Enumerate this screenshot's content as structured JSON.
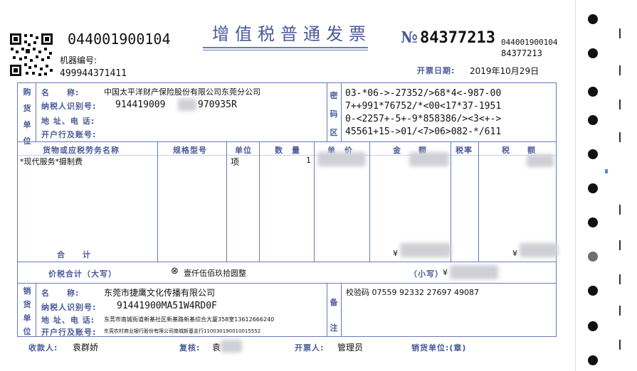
{
  "header": {
    "code_top": "044001900104",
    "machine_label": "机器编号:",
    "machine_no": "499944371411",
    "title": "增值税普通发票",
    "no_symbol": "№",
    "invoice_no": "84377213",
    "code_small": "044001900104",
    "no_small": "84377213",
    "date_label": "开票日期:",
    "date": "2019年10月29日"
  },
  "buyer": {
    "section_label": [
      "购",
      "货",
      "单",
      "位"
    ],
    "name_label": "名　　称:",
    "name": "中国太平洋财产保险股份有限公司东莞分公司",
    "tax_label": "纳税人识别号:",
    "tax_id_part1": "914419009",
    "tax_id_part2": "970935R",
    "addr_label": "地 址、电 话:",
    "bank_label": "开户行及账号:"
  },
  "cipher": {
    "label": [
      "密",
      "码",
      "区"
    ],
    "lines": [
      "03-*06->-27352/>68*4<-987-00",
      "7++991*76752/*<00<17*37-1951",
      "0-<2257+-5+-9*858386/><3<+->",
      "45561+15->01/<7>06>082-*/611"
    ]
  },
  "items": {
    "headers": [
      "货物或应税劳务名称",
      "规格型号",
      "单位",
      "数　量",
      "单　价",
      "金　　额",
      "税率",
      "税　　额"
    ],
    "rows": [
      {
        "name": "*现代服务*摄制费",
        "spec": "",
        "unit": "项",
        "qty": "1"
      }
    ],
    "total_label": "合　　计",
    "yen": "¥"
  },
  "total": {
    "label": "价税合计（大写）",
    "circle": "⊗",
    "amount_upper": "壹仟伍佰玖拾圆整",
    "small_label": "（小写）",
    "yen": "¥"
  },
  "seller": {
    "section_label": [
      "销",
      "货",
      "单",
      "位"
    ],
    "name_label": "名　　称:",
    "name": "东莞市捷鹰文化传播有限公司",
    "tax_label": "纳税人识别号:",
    "tax_id": "91441900MA51W4RD0F",
    "addr_label": "地 址、电 话:",
    "addr": "东莞市南城街道新基社区新基路新基综合大厦358室13612666240",
    "bank_label": "开户行及账号:",
    "bank": "东莞农村商业银行股份有限公司南城新基支行110030190010015552"
  },
  "remarks": {
    "label": [
      "备",
      "注"
    ],
    "check_code": "校验码 07559 92332 27697 49087"
  },
  "footer": {
    "payee_label": "收款人:",
    "payee": "袁群娇",
    "reviewer_label": "复核:",
    "reviewer": "袁",
    "issuer_label": "开票人:",
    "issuer": "管理员",
    "seller_stamp_label": "销货单位:(章)"
  },
  "colors": {
    "frame": "#6a7ab8",
    "label": "#4a5a9a",
    "ink": "#111111"
  }
}
